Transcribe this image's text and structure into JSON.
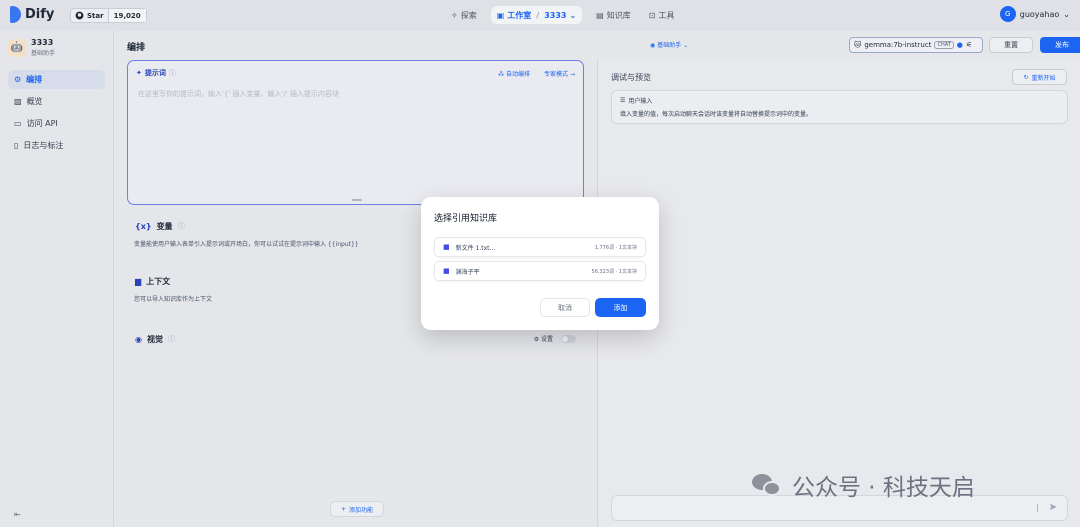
{
  "brand": {
    "name": "Dify"
  },
  "github": {
    "star_label": "Star",
    "star_count": "19,020"
  },
  "nav": {
    "explore": "探索",
    "studio": "工作室",
    "app": "3333",
    "knowledge": "知识库",
    "tools": "工具"
  },
  "user": {
    "initial": "G",
    "name": "guoyahao"
  },
  "app": {
    "name": "3333",
    "type": "基础助手"
  },
  "sidebar": {
    "items": [
      {
        "label": "编排"
      },
      {
        "label": "概览"
      },
      {
        "label": "访问 API"
      },
      {
        "label": "日志与标注"
      }
    ]
  },
  "header": {
    "title": "编排",
    "assistant_mode": "基础助手",
    "model": "gemma:7b-instruct",
    "model_badge": "CHAT",
    "reset_label": "重置",
    "publish_label": "发布"
  },
  "prompt": {
    "label": "提示词",
    "auto_label": "自动编排",
    "expert_label": "专家模式",
    "placeholder": "在这里写你的提示词，输入'{' 插入变量、输入'/' 插入提示内容块"
  },
  "variables": {
    "title": "变量",
    "desc": "变量能使用户输入表单引入提示词或开场白，你可以试试在提示词中输入 {{input}}"
  },
  "context": {
    "title": "上下文",
    "desc": "您可以导入知识库作为上下文"
  },
  "vision": {
    "title": "视觉",
    "settings_label": "设置"
  },
  "add_feature": {
    "label": "添加功能"
  },
  "debug": {
    "title": "调试与预览",
    "restart_label": "重新开始",
    "user_input_title": "用户输入",
    "user_input_desc": "填入变量的值，每次启动聊天会话时该变量将自动替换提示词中的变量。"
  },
  "modal": {
    "title": "选择引用知识库",
    "items": [
      {
        "name": "新文件 1.txt...",
        "meta": "1,776词 · 1文本块"
      },
      {
        "name": "渊海子平",
        "meta": "56,323词 · 1文本块"
      }
    ],
    "cancel_label": "取消",
    "add_label": "添加"
  },
  "watermark": {
    "text": "公众号 · 科技天启"
  },
  "colors": {
    "primary": "#1c64f2",
    "prompt_border": "#6f7fe6"
  }
}
